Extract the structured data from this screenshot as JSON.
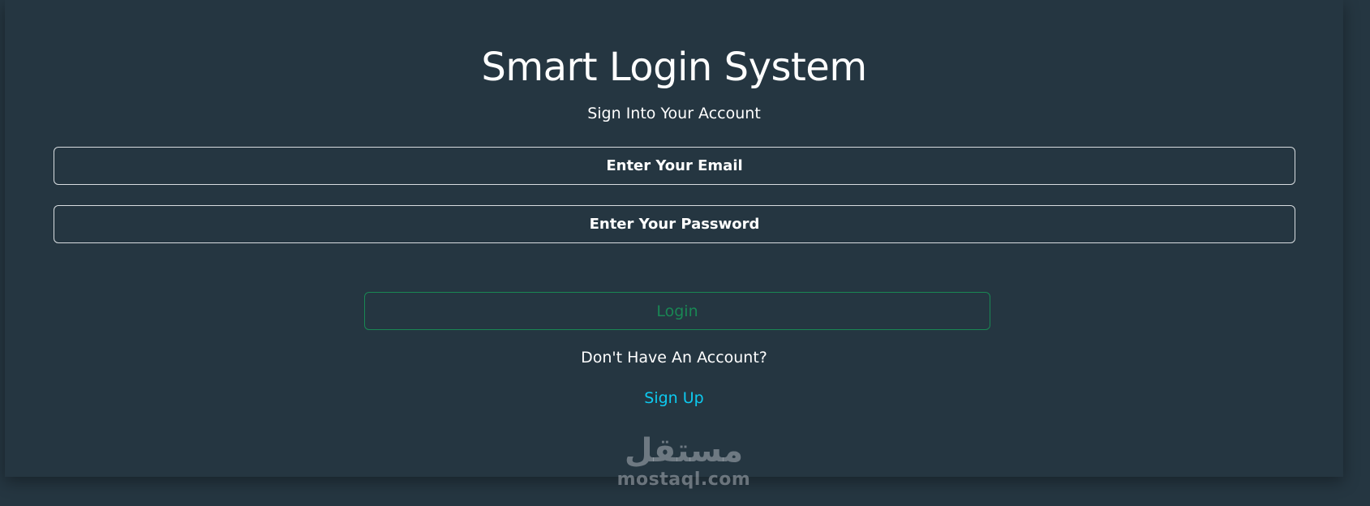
{
  "header": {
    "title": "Smart Login System",
    "subtitle": "Sign Into Your Account"
  },
  "form": {
    "email_placeholder": "Enter Your Email",
    "email_value": "",
    "password_placeholder": "Enter Your Password",
    "password_value": "",
    "login_label": "Login"
  },
  "footer": {
    "prompt": "Don't Have An Account?",
    "signup_label": "Sign Up"
  },
  "watermark": {
    "arabic": "مستقل",
    "latin": "mostaql.com"
  },
  "colors": {
    "background": "#253641",
    "login_accent": "#198754",
    "link_accent": "#0dcaf0"
  }
}
